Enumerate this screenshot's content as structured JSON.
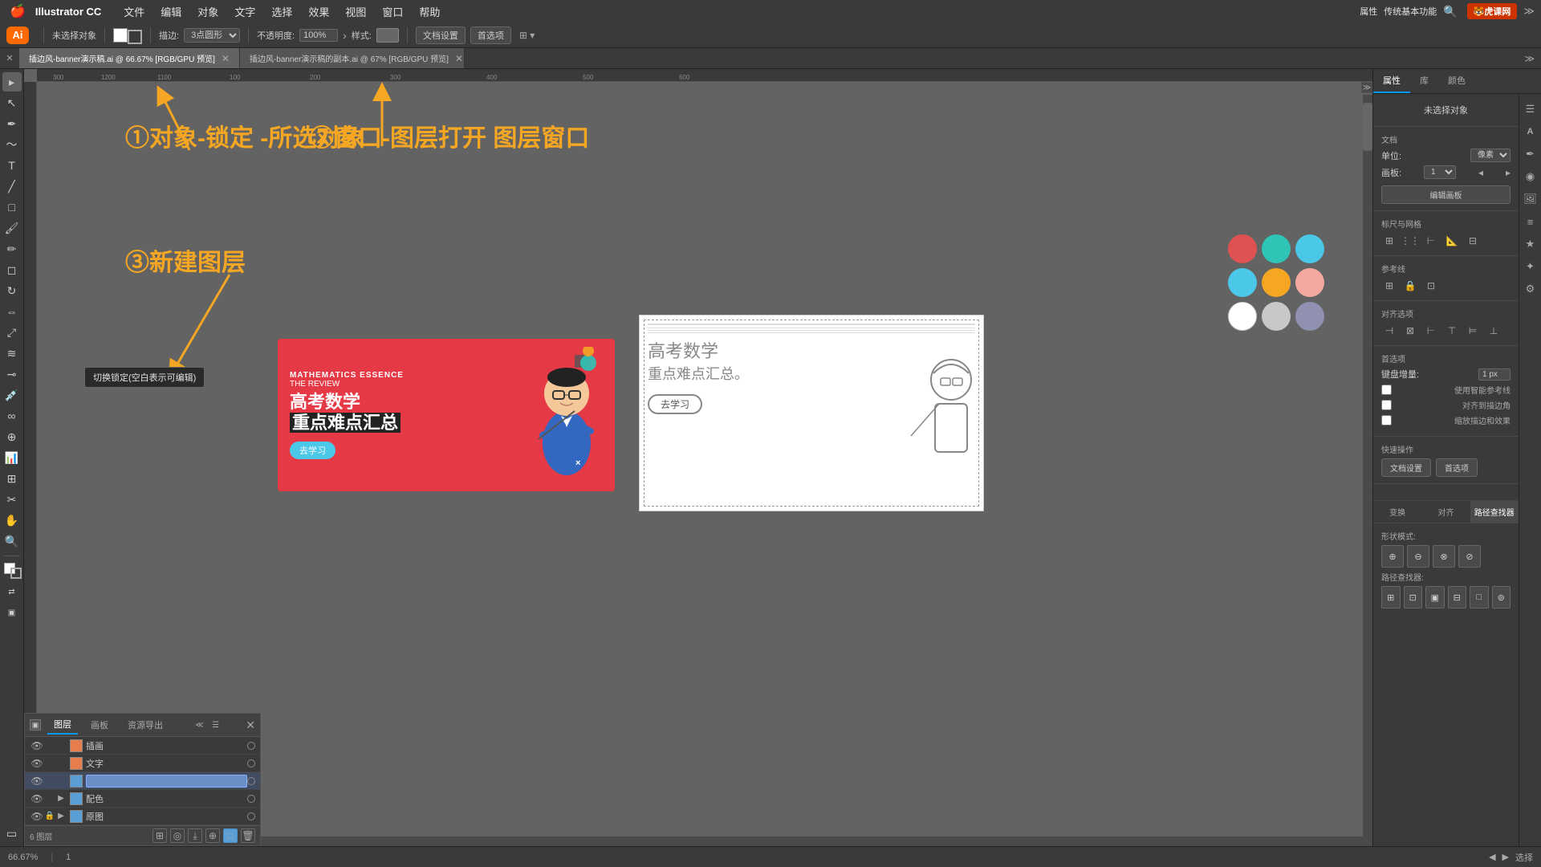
{
  "app": {
    "name": "Illustrator CC",
    "ai_logo": "Ai",
    "version": "传统基本功能"
  },
  "menubar": {
    "apple": "🍎",
    "items": [
      "Illustrator CC",
      "文件",
      "编辑",
      "对象",
      "文字",
      "选择",
      "效果",
      "视图",
      "窗口",
      "帮助"
    ]
  },
  "toolbar": {
    "no_selection": "未选择对象",
    "stroke_label": "描边:",
    "stroke_value": "3点圆形",
    "opacity_label": "不透明度:",
    "opacity_value": "100%",
    "style_label": "样式:",
    "doc_setup": "文档设置",
    "preferences": "首选项"
  },
  "tabs": [
    {
      "label": "插边风-banner演示稿.ai @ 66.67% [RGB/GPU 预览]",
      "active": true
    },
    {
      "label": "插边风-banner演示稿的副本.ai @ 67% [RGB/GPU 预览]",
      "active": false
    }
  ],
  "canvas": {
    "zoom": "66.67%",
    "page": "1",
    "mode": "选择",
    "annotation1": "①对象-锁定\n-所选对象",
    "annotation2": "②窗口-图层打开\n图层窗口",
    "annotation3": "③新建图层",
    "arrow1_label": "→ 对象菜单",
    "arrow2_label": "→ 窗口菜单"
  },
  "math_banner": {
    "top_text": "MATHEMATICS ESSENCE",
    "subtitle": "THE REVIEW",
    "title_line1": "高考数学",
    "title_line2": "重点难点汇总",
    "btn_text": "去学习"
  },
  "sketch_banner": {
    "title_line1": "高考数学",
    "title_line2": "重点难点汇总。",
    "btn_text": "去学习"
  },
  "color_swatches": [
    {
      "color": "#e05252",
      "name": "red"
    },
    {
      "color": "#2ec4b6",
      "name": "teal"
    },
    {
      "color": "#4bc8e8",
      "name": "blue"
    },
    {
      "color": "#4bc8e8",
      "name": "light-blue"
    },
    {
      "color": "#f5a623",
      "name": "orange"
    },
    {
      "color": "#f4a8a0",
      "name": "pink"
    },
    {
      "color": "#ffffff",
      "name": "white"
    },
    {
      "color": "#c8c8c8",
      "name": "gray"
    },
    {
      "color": "#9090b0",
      "name": "blue-gray"
    }
  ],
  "right_panel": {
    "tabs": [
      "属性",
      "库",
      "颜色"
    ],
    "title": "未选择对象",
    "doc_section": {
      "label": "文档",
      "unit_label": "单位:",
      "unit_value": "像素",
      "artboard_label": "画板:",
      "artboard_value": "1",
      "edit_btn": "编辑画板"
    },
    "grid_section": {
      "label": "标尺与网格"
    },
    "guides_section": {
      "label": "参考线"
    },
    "align_section": {
      "label": "对齐选项"
    },
    "snap_section": {
      "label": "首选项",
      "snap_px_label": "键盘增量:",
      "snap_px_value": "1 px",
      "smart_guides": "使用智能参考线",
      "snap_corners": "对齐到描边角",
      "snap_effects": "缩放描边和效果"
    },
    "quick_actions": {
      "label": "快速操作",
      "doc_setup_btn": "文档设置",
      "prefs_btn": "首选项"
    },
    "bottom_tabs": [
      "变换",
      "对齐",
      "路径查找器"
    ],
    "pathfinder_label": "形状模式:",
    "pathrouter_label": "路径查找器:"
  },
  "layers_panel": {
    "tabs": [
      "图层",
      "画板",
      "资源导出"
    ],
    "layers": [
      {
        "name": "插画",
        "visible": true,
        "locked": false,
        "color": "#e87c4c",
        "has_sub": false
      },
      {
        "name": "文字",
        "visible": true,
        "locked": false,
        "color": "#e87c4c",
        "has_sub": false
      },
      {
        "name": "",
        "visible": true,
        "locked": false,
        "color": "#5a9ed6",
        "has_sub": false,
        "editing": true
      },
      {
        "name": "配色",
        "visible": true,
        "locked": false,
        "color": "#5a9ed6",
        "has_sub": true
      },
      {
        "name": "原图",
        "visible": true,
        "locked": true,
        "color": "#5a9ed6",
        "has_sub": true
      }
    ],
    "footer_label": "6 图层",
    "footer_actions": [
      "new_layer",
      "delete_layer",
      "move_up",
      "move_down",
      "options"
    ]
  },
  "tooltip": {
    "text": "切换锁定(空白表示可编辑)"
  },
  "statusbar": {
    "zoom": "66.67%",
    "page_label": "1",
    "mode": "选择"
  }
}
